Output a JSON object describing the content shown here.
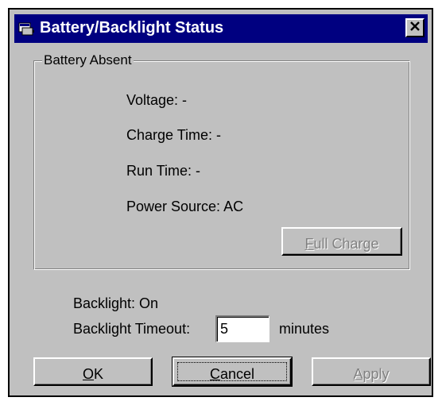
{
  "window": {
    "title": "Battery/Backlight Status",
    "close_glyph": "✕",
    "icon": "battery-window-icon"
  },
  "battery_group": {
    "legend": "Battery Absent",
    "voltage": "Voltage: -",
    "charge_time": "Charge Time: -",
    "run_time": "Run Time: -",
    "power_source": "Power Source: AC",
    "full_charge": {
      "mnemonic": "F",
      "rest": "ull Charge",
      "enabled": false
    }
  },
  "backlight": {
    "status": "Backlight: On",
    "timeout_label": "Backlight Timeout:",
    "timeout_value": "5",
    "timeout_units": "minutes"
  },
  "buttons": {
    "ok": {
      "mnemonic": "O",
      "rest": "K",
      "enabled": true
    },
    "cancel": {
      "mnemonic": "C",
      "rest": "ancel",
      "enabled": true,
      "focused": true
    },
    "apply": {
      "mnemonic": "A",
      "rest": "pply",
      "enabled": false
    }
  },
  "colors": {
    "title_bar": "#000080",
    "face": "#c0c0c0",
    "disabled_text": "#808080"
  }
}
